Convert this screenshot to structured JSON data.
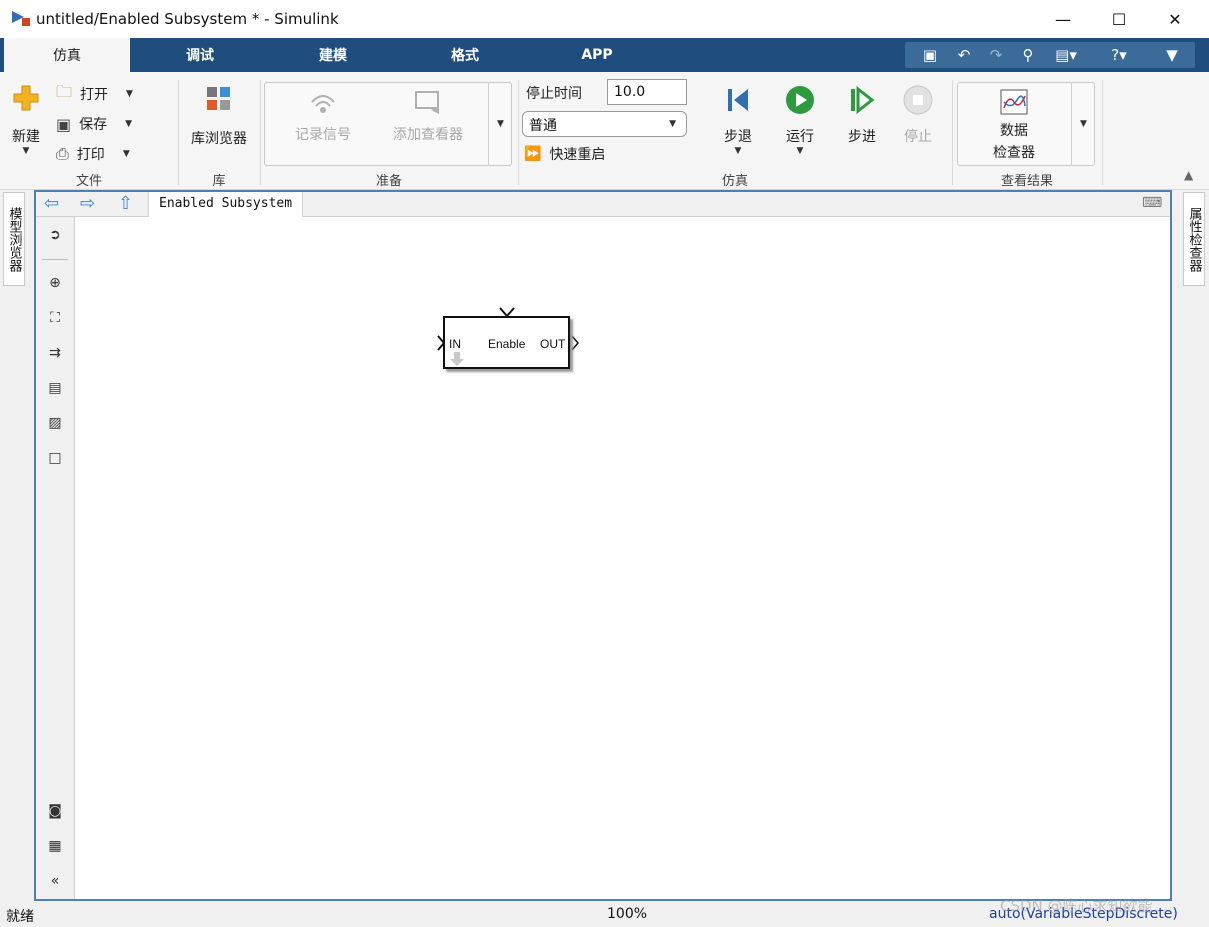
{
  "window": {
    "title": "untitled/Enabled Subsystem * - Simulink",
    "minimize": "—",
    "maximize": "☐",
    "close": "✕"
  },
  "tabs": [
    {
      "label": "仿真",
      "active": true
    },
    {
      "label": "调试"
    },
    {
      "label": "建模"
    },
    {
      "label": "格式"
    },
    {
      "label": "APP"
    }
  ],
  "quick_access": {
    "icons": [
      "save-icon",
      "undo-icon",
      "redo-icon",
      "search-icon",
      "customize-icon",
      "help-icon",
      "collapse-icon"
    ]
  },
  "ribbon": {
    "file": {
      "section": "文件",
      "new": "新建",
      "open": "打开",
      "save": "保存",
      "print": "打印"
    },
    "library": {
      "section": "库",
      "browser": "库浏览器"
    },
    "prepare": {
      "section": "准备",
      "log_signals": "记录信号",
      "add_viewer": "添加查看器"
    },
    "simulate": {
      "section": "仿真",
      "stop_time_label": "停止时间",
      "stop_time": "10.0",
      "mode": "普通",
      "fast_restart": "快速重启",
      "step_back": "步退",
      "run": "运行",
      "step_forward": "步进",
      "stop": "停止"
    },
    "results": {
      "section": "查看结果",
      "inspector_line1": "数据",
      "inspector_line2": "检查器"
    }
  },
  "editor": {
    "breadcrumb": "Enabled Subsystem"
  },
  "side_tabs": {
    "left": "模型浏览器",
    "right": "属性检查器"
  },
  "block": {
    "in_port": "IN",
    "title": "Enable",
    "out_port": "OUT"
  },
  "status": {
    "state": "就绪",
    "zoom": "100%",
    "solver": "auto(VariableStepDiscrete)"
  },
  "watermark": "CSDN @陈心求知欲能",
  "colors": {
    "tab_bar": "#1f4d7e",
    "accent": "#4d81b5",
    "run_green": "#2e9a3e",
    "solver_link": "#1a3fa8"
  }
}
